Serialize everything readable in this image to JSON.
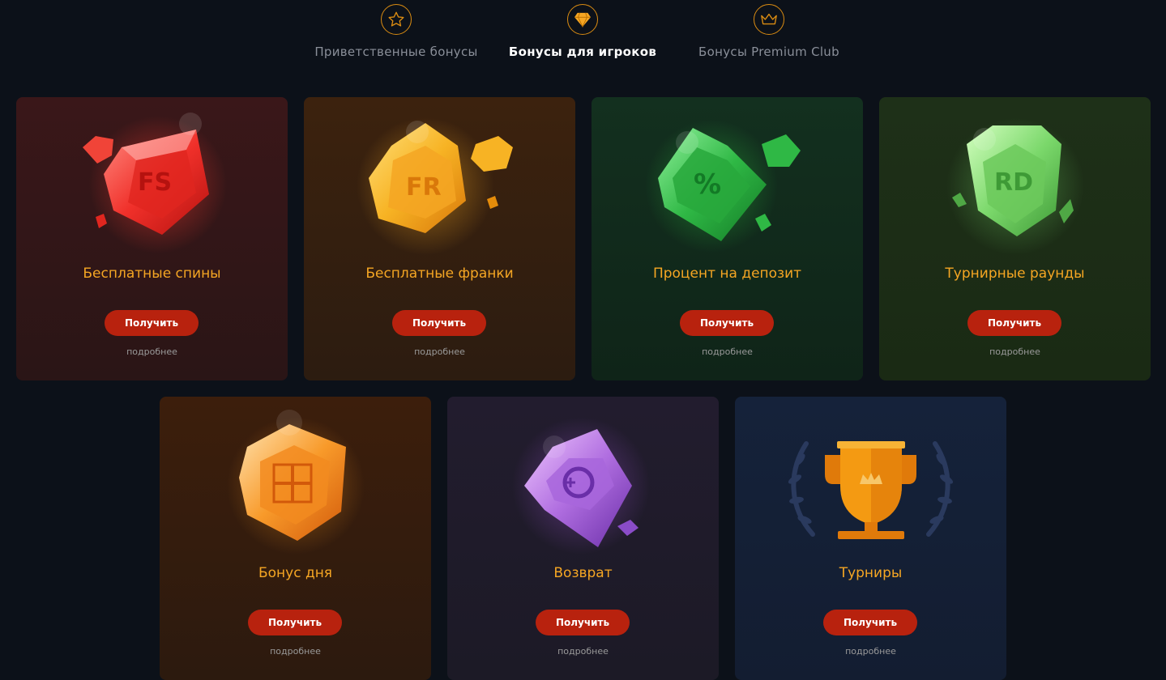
{
  "tabs": [
    {
      "label": "Приветственные бонусы",
      "icon": "star-icon",
      "active": false
    },
    {
      "label": "Бонусы для игроков",
      "icon": "diamond-icon",
      "active": true
    },
    {
      "label": "Бонусы Premium Club",
      "icon": "crown-icon",
      "active": false
    }
  ],
  "accent_color": "#d98b12",
  "button_color": "#b8220e",
  "title_color": "#f5a623",
  "cards": [
    {
      "title": "Бесплатные спины",
      "gem_label": "FS",
      "gem_icon": "red-gem-icon",
      "button": "Получить",
      "link": "подробнее"
    },
    {
      "title": "Бесплатные франки",
      "gem_label": "FR",
      "gem_icon": "gold-gem-icon",
      "button": "Получить",
      "link": "подробнее"
    },
    {
      "title": "Процент на депозит",
      "gem_label": "%",
      "gem_icon": "green-gem-icon",
      "button": "Получить",
      "link": "подробнее"
    },
    {
      "title": "Турнирные раунды",
      "gem_label": "RD",
      "gem_icon": "lime-gem-icon",
      "button": "Получить",
      "link": "подробнее"
    },
    {
      "title": "Бонус дня",
      "gem_icon": "gift-gem-icon",
      "button": "Получить",
      "link": "подробнее"
    },
    {
      "title": "Возврат",
      "gem_icon": "cashback-gem-icon",
      "button": "Получить",
      "link": "подробнее"
    },
    {
      "title": "Турниры",
      "gem_icon": "trophy-icon",
      "button": "Получить",
      "link": "подробнее"
    }
  ]
}
